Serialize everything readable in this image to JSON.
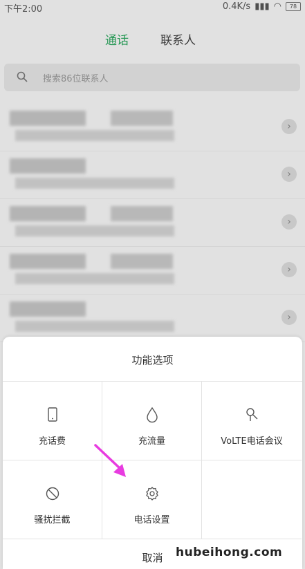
{
  "status_bar": {
    "time": "下午2:00",
    "speed": "0.4K/s",
    "battery": "78"
  },
  "tabs": {
    "calls": "通话",
    "contacts": "联系人"
  },
  "search": {
    "placeholder": "搜索86位联系人"
  },
  "contacts_rows": 5,
  "sheet": {
    "title": "功能选项",
    "options": [
      {
        "label": "充话费",
        "icon": "phone-icon"
      },
      {
        "label": "充流量",
        "icon": "drop-icon"
      },
      {
        "label": "VoLTE电话会议",
        "icon": "conference-icon"
      },
      {
        "label": "骚扰拦截",
        "icon": "block-icon"
      },
      {
        "label": "电话设置",
        "icon": "gear-icon"
      }
    ],
    "cancel": "取消"
  },
  "watermark": "hubeihong.com",
  "colors": {
    "accent": "#27a35a",
    "arrow": "#e83ce0"
  }
}
